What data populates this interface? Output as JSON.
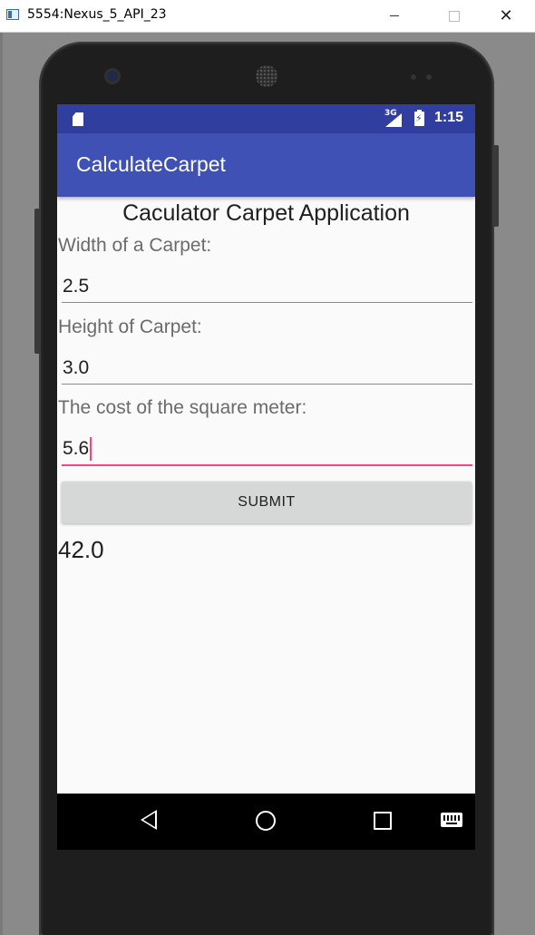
{
  "window": {
    "title": "5554:Nexus_5_API_23",
    "minimize_label": "",
    "maximize_label": "",
    "close_label": "✕"
  },
  "status_bar": {
    "network": "3G",
    "time": "1:15"
  },
  "app": {
    "title": "CalculateCarpet"
  },
  "form": {
    "heading": "Caculator Carpet Application",
    "width_label": "Width of a Carpet:",
    "width_value": "2.5",
    "height_label": "Height of Carpet:",
    "height_value": "3.0",
    "cost_label": "The cost of the square meter:",
    "cost_value": "5.6",
    "submit_label": "SUBMIT",
    "result": "42.0"
  },
  "colors": {
    "status_bar": "#303f9f",
    "app_bar": "#3f51b5",
    "accent": "#ff4081",
    "button": "#d6d7d7"
  },
  "nav_icons": [
    "back-icon",
    "home-icon",
    "recent-apps-icon",
    "keyboard-icon"
  ]
}
